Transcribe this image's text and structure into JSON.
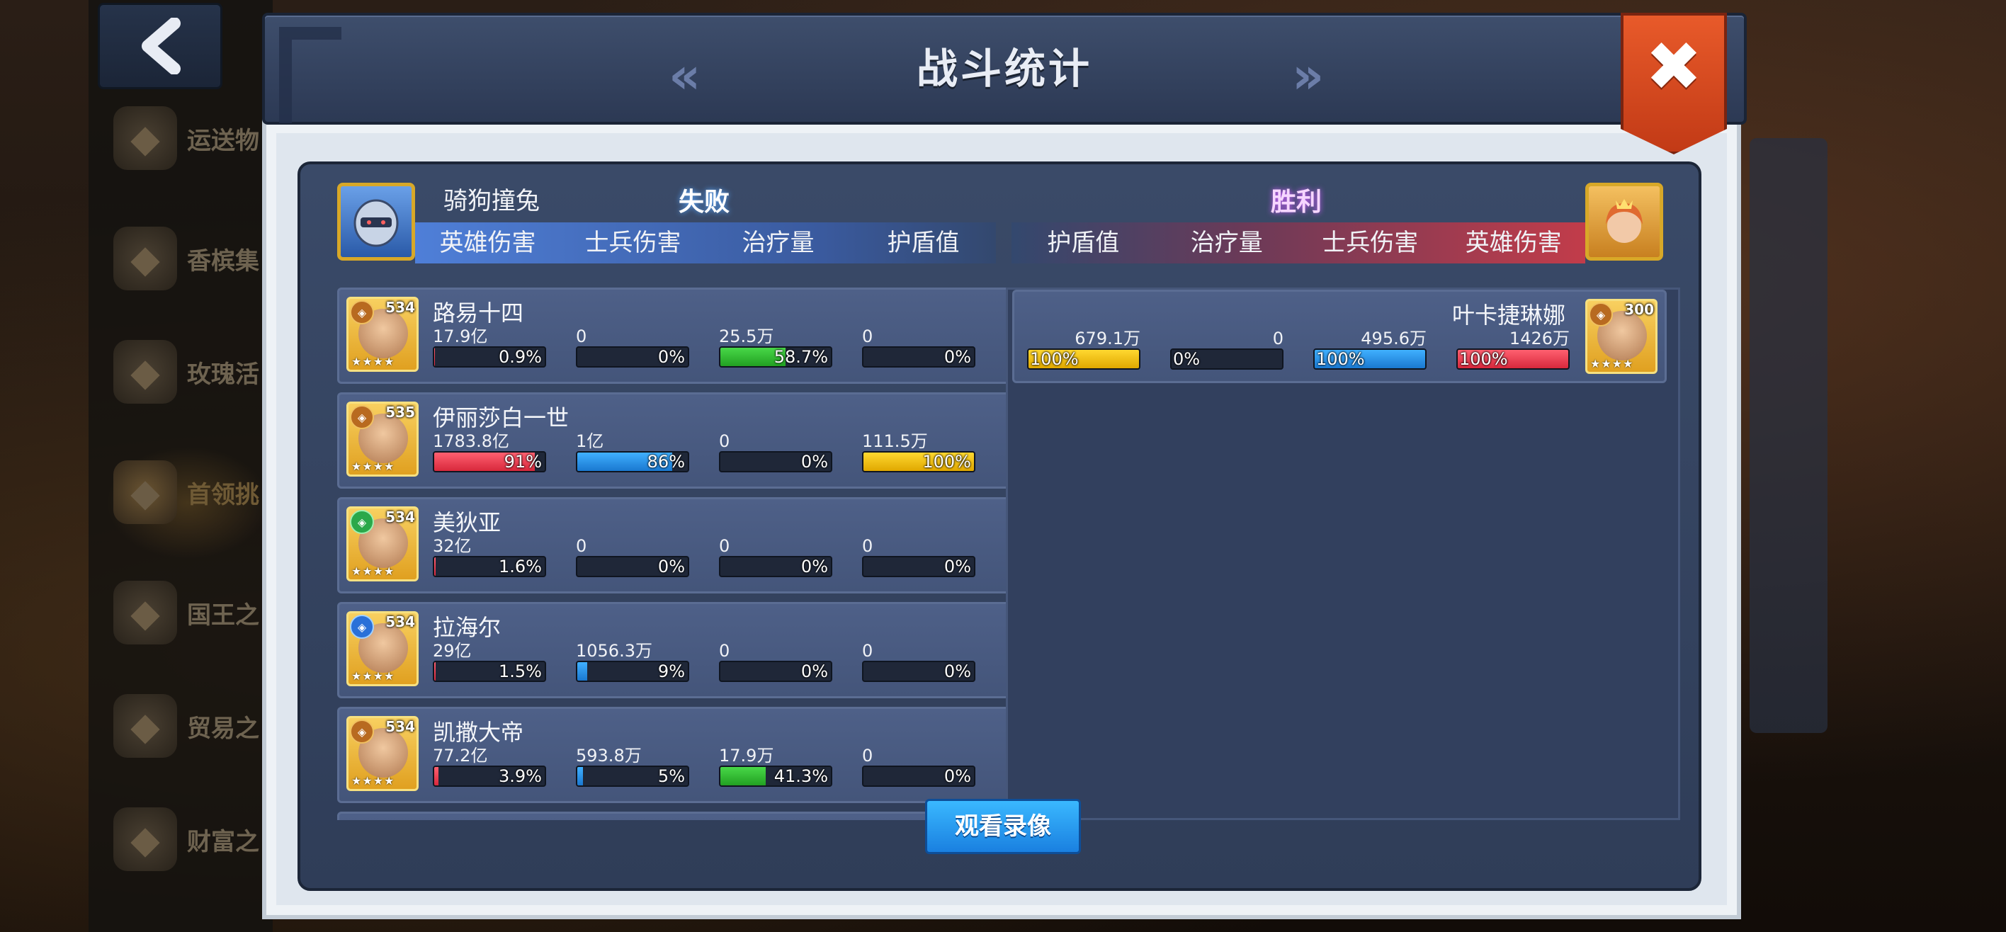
{
  "sidebar": {
    "items": [
      {
        "label": "运送物",
        "icon": "map-icon"
      },
      {
        "label": "香槟集",
        "icon": "champagne-icon"
      },
      {
        "label": "玫瑰活",
        "icon": "rose-icon"
      },
      {
        "label": "首领挑",
        "icon": "demon-skull-icon"
      },
      {
        "label": "国王之",
        "icon": "crown-icon"
      },
      {
        "label": "贸易之",
        "icon": "trade-icon"
      },
      {
        "label": "财富之",
        "icon": "treasure-chest-icon"
      }
    ]
  },
  "dialog": {
    "title": "战斗统计",
    "close_icon": "close-icon"
  },
  "left_side": {
    "player_name": "骑狗撞兔",
    "result": "失败",
    "columns": [
      "英雄伤害",
      "士兵伤害",
      "治疗量",
      "护盾值"
    ],
    "heroes": [
      {
        "name": "路易十四",
        "level": "534",
        "faction": "orange",
        "stats": [
          {
            "value": "17.9亿",
            "pct": "0.9%",
            "fill": 0.009,
            "color": "red"
          },
          {
            "value": "0",
            "pct": "0%",
            "fill": 0,
            "color": "blue"
          },
          {
            "value": "25.5万",
            "pct": "58.7%",
            "fill": 0.587,
            "color": "green"
          },
          {
            "value": "0",
            "pct": "0%",
            "fill": 0,
            "color": "yellow"
          }
        ]
      },
      {
        "name": "伊丽莎白一世",
        "level": "535",
        "faction": "orange",
        "stats": [
          {
            "value": "1783.8亿",
            "pct": "91%",
            "fill": 0.91,
            "color": "red"
          },
          {
            "value": "1亿",
            "pct": "86%",
            "fill": 0.86,
            "color": "blue"
          },
          {
            "value": "0",
            "pct": "0%",
            "fill": 0,
            "color": "green"
          },
          {
            "value": "111.5万",
            "pct": "100%",
            "fill": 1.0,
            "color": "yellow"
          }
        ]
      },
      {
        "name": "美狄亚",
        "level": "534",
        "faction": "green",
        "stats": [
          {
            "value": "32亿",
            "pct": "1.6%",
            "fill": 0.016,
            "color": "red"
          },
          {
            "value": "0",
            "pct": "0%",
            "fill": 0,
            "color": "blue"
          },
          {
            "value": "0",
            "pct": "0%",
            "fill": 0,
            "color": "green"
          },
          {
            "value": "0",
            "pct": "0%",
            "fill": 0,
            "color": "yellow"
          }
        ]
      },
      {
        "name": "拉海尔",
        "level": "534",
        "faction": "blue",
        "stats": [
          {
            "value": "29亿",
            "pct": "1.5%",
            "fill": 0.015,
            "color": "red"
          },
          {
            "value": "1056.3万",
            "pct": "9%",
            "fill": 0.09,
            "color": "blue"
          },
          {
            "value": "0",
            "pct": "0%",
            "fill": 0,
            "color": "green"
          },
          {
            "value": "0",
            "pct": "0%",
            "fill": 0,
            "color": "yellow"
          }
        ]
      },
      {
        "name": "凯撒大帝",
        "level": "534",
        "faction": "yellow",
        "stats": [
          {
            "value": "77.2亿",
            "pct": "3.9%",
            "fill": 0.039,
            "color": "red"
          },
          {
            "value": "593.8万",
            "pct": "5%",
            "fill": 0.05,
            "color": "blue"
          },
          {
            "value": "17.9万",
            "pct": "41.3%",
            "fill": 0.413,
            "color": "green"
          },
          {
            "value": "0",
            "pct": "0%",
            "fill": 0,
            "color": "yellow"
          }
        ]
      }
    ]
  },
  "right_side": {
    "result": "胜利",
    "columns": [
      "护盾值",
      "治疗量",
      "士兵伤害",
      "英雄伤害"
    ],
    "heroes": [
      {
        "name": "叶卡捷琳娜",
        "level": "300",
        "faction": "orange",
        "stats": [
          {
            "value": "679.1万",
            "pct": "100%",
            "fill": 1.0,
            "color": "yellow"
          },
          {
            "value": "0",
            "pct": "0%",
            "fill": 0,
            "color": "green"
          },
          {
            "value": "495.6万",
            "pct": "100%",
            "fill": 1.0,
            "color": "blue"
          },
          {
            "value": "1426万",
            "pct": "100%",
            "fill": 1.0,
            "color": "red"
          }
        ]
      }
    ]
  },
  "footer": {
    "watch_replay_label": "观看录像"
  },
  "colors": {
    "close_button": "#d84a20",
    "watch_button": "#2a9cf0",
    "lose_glow": "#5aa8ff",
    "win_glow": "#d060ff"
  }
}
